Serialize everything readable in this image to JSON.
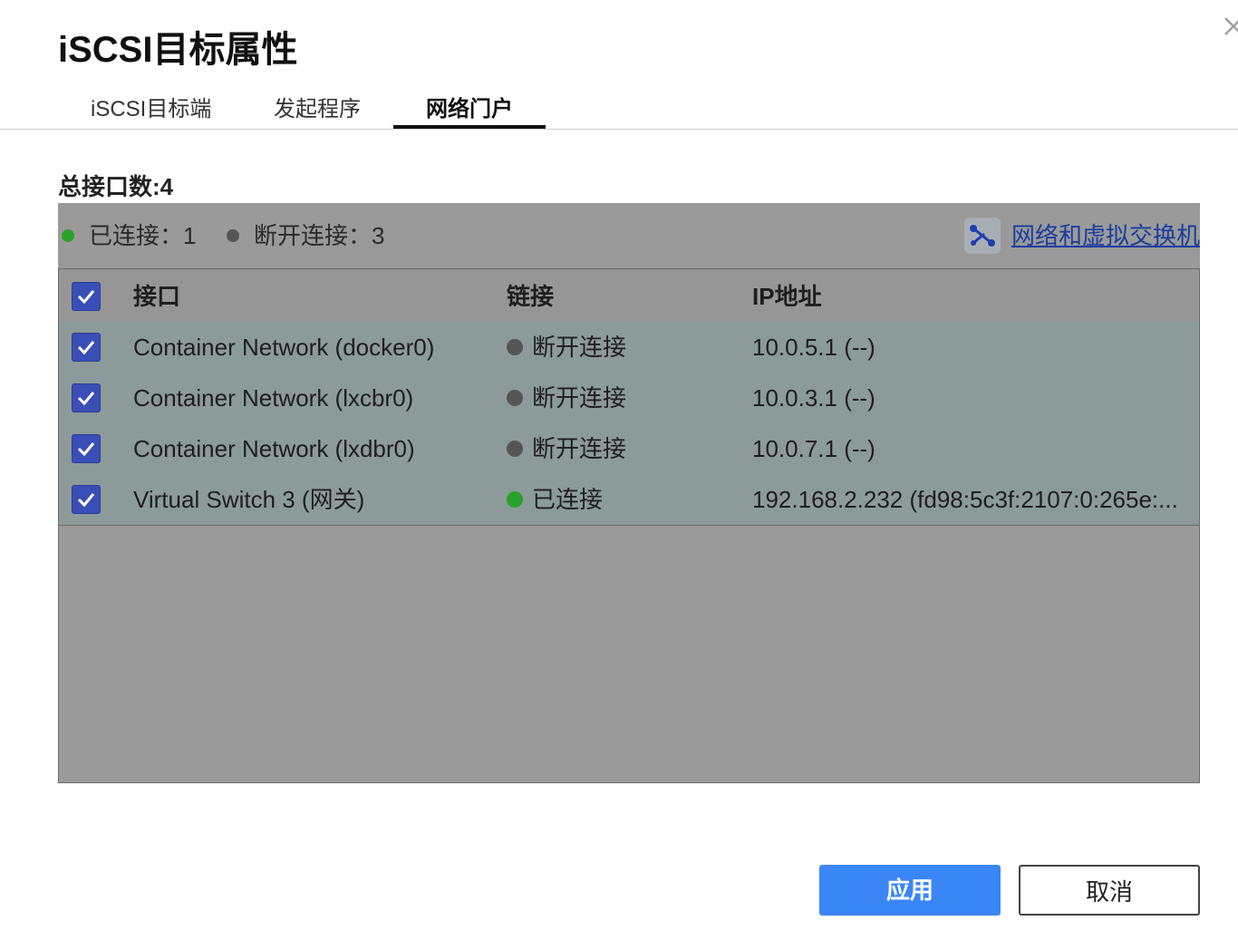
{
  "dialog": {
    "title": "iSCSI目标属性",
    "close_icon": "close-icon"
  },
  "tabs": [
    {
      "label": "iSCSI目标端",
      "active": false
    },
    {
      "label": "发起程序",
      "active": false
    },
    {
      "label": "网络门户",
      "active": true
    }
  ],
  "summary": {
    "total_label": "总接口数:4",
    "connected_label": "已连接：1",
    "disconnected_label": "断开连接：3",
    "network_link_label": "网络和虚拟交换机",
    "network_link_icon": "network-switch-icon"
  },
  "table": {
    "columns": [
      "接口",
      "链接",
      "IP地址"
    ],
    "header_checked": true,
    "rows": [
      {
        "checked": true,
        "interface": "Container Network (docker0)",
        "status": "断开连接",
        "status_color": "#555555",
        "ip": "10.0.5.1 (--)"
      },
      {
        "checked": true,
        "interface": "Container Network (lxcbr0)",
        "status": "断开连接",
        "status_color": "#555555",
        "ip": "10.0.3.1 (--)"
      },
      {
        "checked": true,
        "interface": "Container Network (lxdbr0)",
        "status": "断开连接",
        "status_color": "#555555",
        "ip": "10.0.7.1 (--)"
      },
      {
        "checked": true,
        "interface": "Virtual Switch 3 (网关)",
        "status": "已连接",
        "status_color": "#2aa12a",
        "ip": "192.168.2.232 (fd98:5c3f:2107:0:265e:..."
      }
    ]
  },
  "buttons": {
    "apply": "应用",
    "cancel": "取消"
  },
  "colors": {
    "accent": "#3b86f7",
    "connected": "#2aa12a",
    "disconnected": "#555555",
    "checkbox": "#3a4fb5"
  }
}
